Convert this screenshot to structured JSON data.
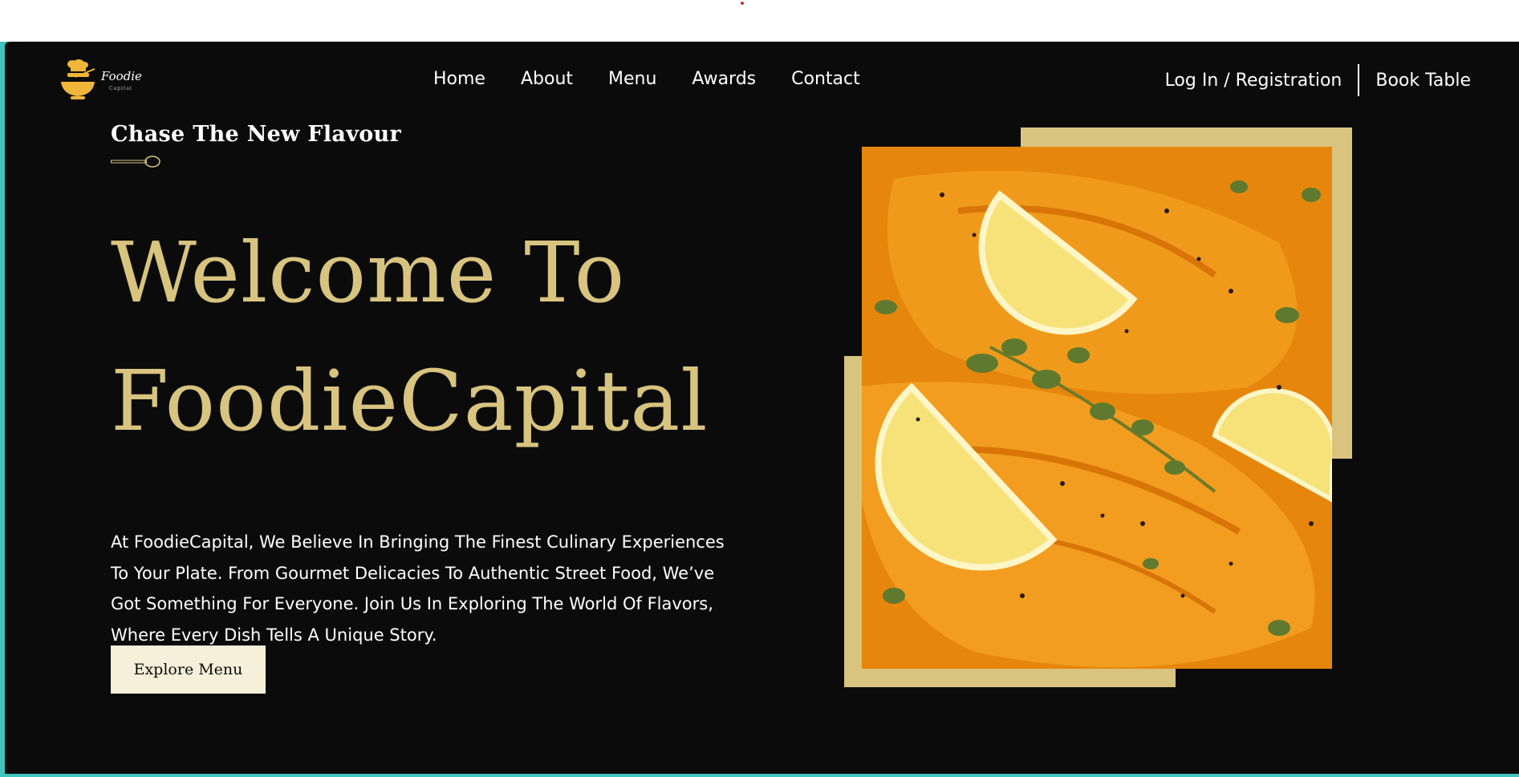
{
  "site": {
    "logo": {
      "text": "Foodie",
      "sub": "Capital",
      "icon": "chef-bowl-logo-icon"
    },
    "nav": [
      "Home",
      "About",
      "Menu",
      "Awards",
      "Contact"
    ],
    "login_label": "Log In / Registration",
    "book_label": "Book Table"
  },
  "hero": {
    "tagline": "Chase The New Flavour",
    "title_line1": "Welcome To",
    "title_line2": "FoodieCapital",
    "description": "At FoodieCapital, We Believe In Bringing The Finest Culinary Experiences To Your Plate. From Gourmet Delicacies To Authentic Street Food, We’ve Got Something For Everyone. Join Us In Exploring The World Of Flavors, Where Every Dish Tells A Unique Story.",
    "cta_label": "Explore Menu",
    "image": "salmon-with-lemon-and-oregano-photo"
  },
  "colors": {
    "background": "#0b0b0b",
    "accent_gold": "#d8c47f",
    "button_bg": "#f6efd9",
    "frame_teal": "#41c4c0",
    "text": "#ffffff"
  }
}
